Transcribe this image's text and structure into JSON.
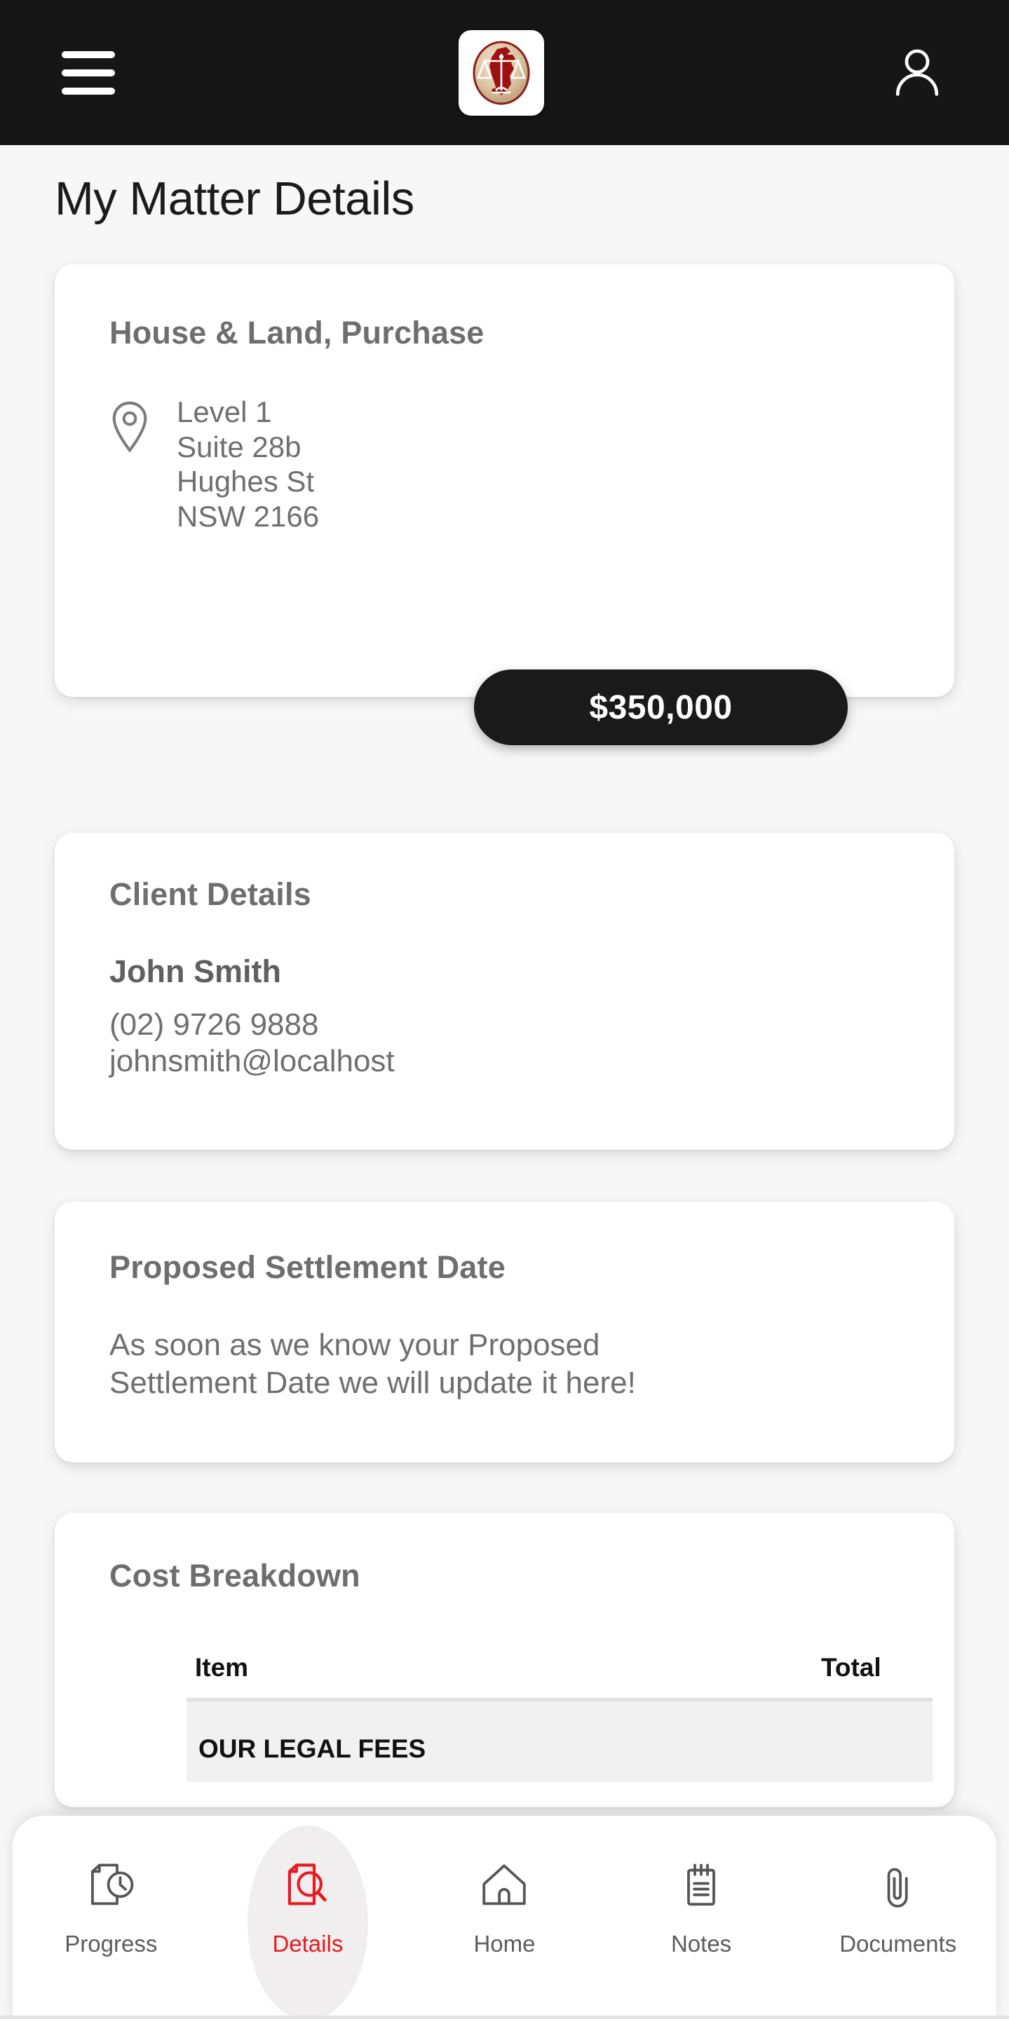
{
  "header": {
    "menu_icon": "hamburger-menu-icon",
    "logo_icon": "scales-of-justice-logo",
    "profile_icon": "user-account-icon",
    "background_color": "#161616"
  },
  "page": {
    "title": "My Matter Details",
    "background_color": "#f7f7f7"
  },
  "matter_card": {
    "title": "House & Land, Purchase",
    "location_icon": "map-pin-icon",
    "address": [
      "Level 1",
      "Suite 28b",
      "Hughes St",
      "NSW 2166"
    ],
    "price": "$350,000",
    "price_background": "#1a1a1a"
  },
  "client_card": {
    "title": "Client Details",
    "name": "John Smith",
    "phone": "(02) 9726 9888",
    "email": "johnsmith@localhost"
  },
  "settlement_card": {
    "title": "Proposed Settlement Date",
    "body": [
      "As soon as we know your Proposed",
      "Settlement Date we will update it here!"
    ]
  },
  "cost_card": {
    "title": "Cost Breakdown",
    "columns": [
      "Item",
      "Total"
    ],
    "rows": [
      {
        "item": "OUR LEGAL FEES",
        "total": ""
      }
    ]
  },
  "bottom_nav": {
    "active_color": "#e8191f",
    "inactive_color": "#5c5c5c",
    "items": [
      {
        "label": "Progress",
        "icon": "document-clock-icon",
        "active": false
      },
      {
        "label": "Details",
        "icon": "document-search-icon",
        "active": true
      },
      {
        "label": "Home",
        "icon": "house-icon",
        "active": false
      },
      {
        "label": "Notes",
        "icon": "notepad-icon",
        "active": false
      },
      {
        "label": "Documents",
        "icon": "paperclip-icon",
        "active": false
      }
    ]
  }
}
